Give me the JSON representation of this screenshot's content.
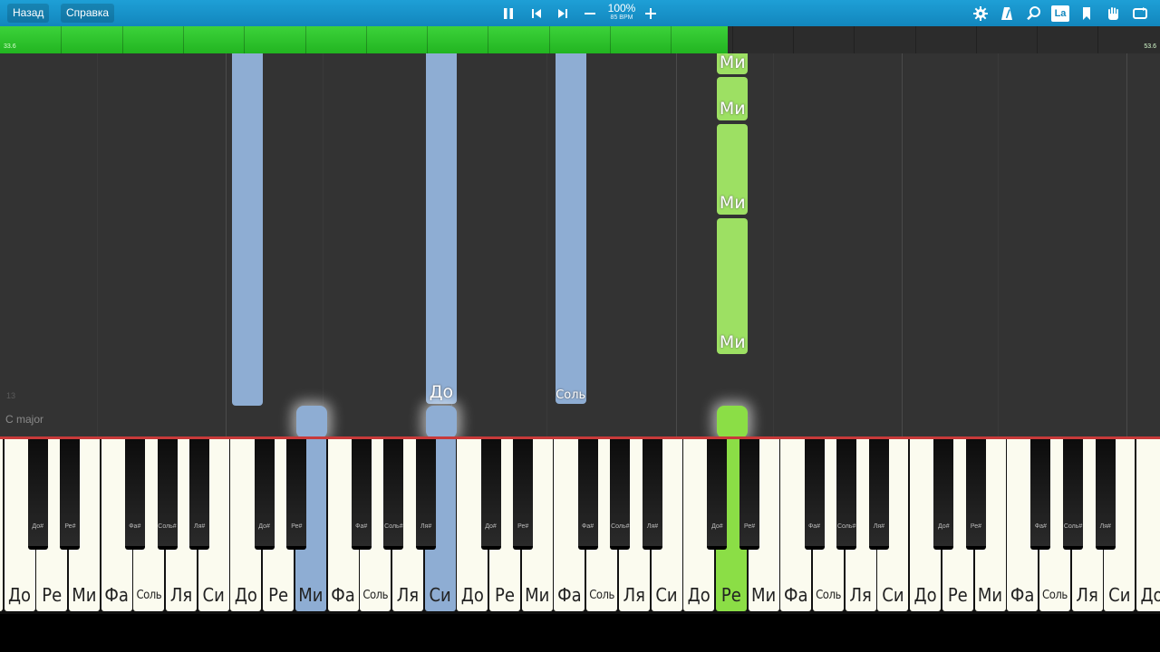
{
  "toolbar": {
    "back_label": "Назад",
    "help_label": "Справка",
    "speed_percent": "100%",
    "bpm": "85 BPM",
    "icons": {
      "pause": "pause-icon",
      "prev": "skip-back-icon",
      "next": "skip-forward-icon",
      "minus": "minus-icon",
      "plus": "plus-icon",
      "settings": "gear-icon",
      "metronome": "metronome-icon",
      "search": "magnifier-icon",
      "la": "La",
      "bookmark": "bookmark-icon",
      "hand": "hand-icon",
      "loop": "loop-icon"
    }
  },
  "progress": {
    "fraction": 0.627,
    "time_left": "33.6",
    "time_right": "53.6",
    "fill_color": "#2ec52b"
  },
  "roll": {
    "key_signature": "C major",
    "measure_number": "13"
  },
  "notes_roll": [
    {
      "key": "white-8",
      "label": "",
      "color": "#8eadd3",
      "top_frac": 0.0,
      "height_frac": 0.92,
      "hand": "left"
    },
    {
      "key": "white-14",
      "label": "До",
      "color": "#8eadd3",
      "top_frac": 0.0,
      "height_frac": 0.915,
      "hand": "left",
      "label_pos": "bottom"
    },
    {
      "key": "white-18",
      "label": "Соль",
      "color": "#8eadd3",
      "top_frac": 0.0,
      "height_frac": 0.915,
      "hand": "left",
      "label_pos": "bottom",
      "small": true
    },
    {
      "key": "white-23",
      "label": "Ми",
      "color": "#9de063",
      "hand": "right",
      "segments": [
        [
          0.0,
          0.055
        ],
        [
          0.062,
          0.175
        ],
        [
          0.185,
          0.42
        ],
        [
          0.43,
          0.785
        ]
      ]
    }
  ],
  "active_keys": [
    {
      "key": "white-10",
      "color": "#8eadd3"
    },
    {
      "key": "white-14",
      "color": "#8eadd3"
    },
    {
      "key": "white-23",
      "color": "#8bde46"
    }
  ],
  "keyboard": {
    "white_labels": [
      "До",
      "Ре",
      "Ми",
      "Фа",
      "Соль",
      "Ля",
      "Си"
    ],
    "black_labels": [
      "До#",
      "Ре#",
      "Фа#",
      "Соль#",
      "Ля#"
    ],
    "first_white_offset": -1
  }
}
